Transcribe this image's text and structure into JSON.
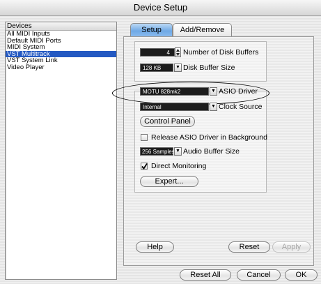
{
  "window": {
    "title": "Device Setup"
  },
  "device_list": {
    "header": "Devices",
    "items": [
      {
        "label": "All MIDI Inputs",
        "selected": false
      },
      {
        "label": "Default MIDI Ports",
        "selected": false
      },
      {
        "label": "MIDI System",
        "selected": false
      },
      {
        "label": "VST Multitrack",
        "selected": true
      },
      {
        "label": "VST System Link",
        "selected": false
      },
      {
        "label": "Video Player",
        "selected": false
      }
    ]
  },
  "tabs": [
    {
      "label": "Setup",
      "active": true
    },
    {
      "label": "Add/Remove",
      "active": false
    }
  ],
  "disk": {
    "buffers_value": "4",
    "buffers_label": "Number of Disk Buffers",
    "buffer_size_value": "128 KB",
    "buffer_size_label": "Disk Buffer Size"
  },
  "asio": {
    "driver_value": "MOTU 828mk2",
    "driver_label": "ASIO Driver",
    "clock_value": "Internal",
    "clock_label": "Clock Source",
    "control_panel_label": "Control Panel",
    "release_label": "Release ASIO Driver in Background",
    "release_checked": false,
    "audio_buffer_value": "256 Samples",
    "audio_buffer_label": "Audio Buffer Size",
    "direct_monitoring_label": "Direct Monitoring",
    "direct_monitoring_checked": true,
    "expert_label": "Expert..."
  },
  "panel_buttons": {
    "help": "Help",
    "reset": "Reset",
    "apply": "Apply"
  },
  "footer_buttons": {
    "reset_all": "Reset All",
    "cancel": "Cancel",
    "ok": "OK"
  },
  "icons": {
    "stepper": "stepper-icon",
    "dropdown": "dropdown-arrow-icon",
    "checkmark": "checkmark-icon"
  }
}
